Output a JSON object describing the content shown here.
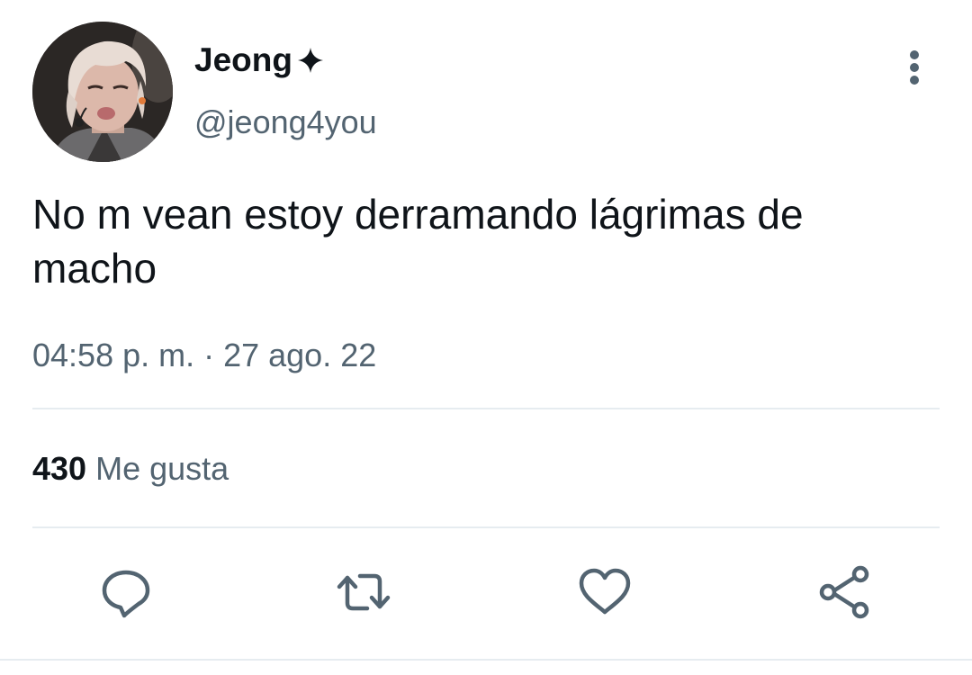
{
  "tweet": {
    "author": {
      "display_name": "Jeong",
      "handle": "@jeong4you",
      "name_icon": "four-point-star-icon"
    },
    "text": "No m vean estoy derramando lágrimas de macho",
    "timestamp": "04:58 p. m. · 27 ago. 22",
    "likes": {
      "count": "430",
      "label": "Me gusta"
    },
    "actions": [
      {
        "name": "reply",
        "icon": "speech-bubble-icon"
      },
      {
        "name": "retweet",
        "icon": "retweet-arrows-icon"
      },
      {
        "name": "like",
        "icon": "heart-icon"
      },
      {
        "name": "share",
        "icon": "share-nodes-icon"
      }
    ]
  },
  "colors": {
    "primary_text": "#0f1419",
    "secondary_text": "#536471",
    "divider": "#e6ecf0",
    "icon": "#536471"
  }
}
